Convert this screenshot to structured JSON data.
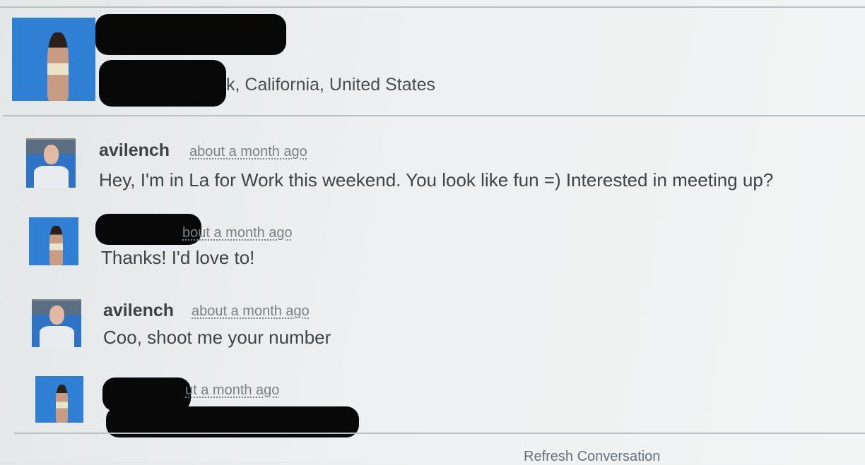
{
  "profile": {
    "location": "k, California, United States"
  },
  "messages": [
    {
      "username": "avilench",
      "timestamp": "about a month ago",
      "text": "Hey, I'm in La for Work this weekend. You look like fun =) Interested in meeting up?"
    },
    {
      "username": "",
      "timestamp": "bout a month ago",
      "text": "Thanks! I'd love to!"
    },
    {
      "username": "avilench",
      "timestamp": "about a month ago",
      "text": "Coo, shoot me your number"
    },
    {
      "username": "",
      "timestamp": "ut a month ago",
      "text": ""
    }
  ],
  "footer": {
    "refresh_label": "Refresh Conversation"
  }
}
